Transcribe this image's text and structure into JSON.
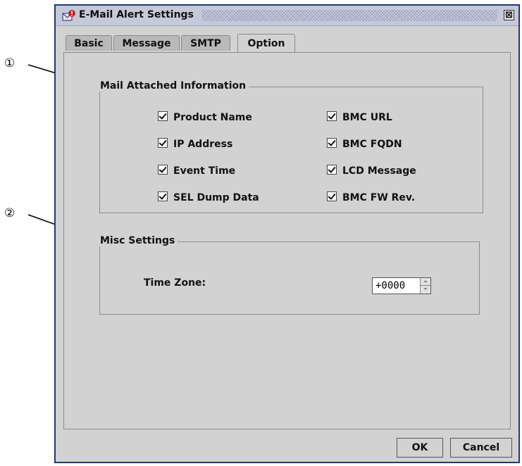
{
  "callouts": {
    "one": "①",
    "two": "②"
  },
  "window": {
    "title": "E-Mail Alert Settings",
    "close_symbol": "⊠"
  },
  "tabs": [
    {
      "label": "Basic"
    },
    {
      "label": "Message"
    },
    {
      "label": "SMTP"
    },
    {
      "label": "Option",
      "active": true
    }
  ],
  "mail_attached": {
    "title": "Mail Attached Information",
    "items": [
      {
        "label": "Product Name",
        "checked": true
      },
      {
        "label": "BMC URL",
        "checked": true
      },
      {
        "label": "IP Address",
        "checked": true
      },
      {
        "label": "BMC FQDN",
        "checked": true
      },
      {
        "label": "Event Time",
        "checked": true
      },
      {
        "label": "LCD Message",
        "checked": true
      },
      {
        "label": "SEL Dump Data",
        "checked": true
      },
      {
        "label": "BMC FW Rev.",
        "checked": true
      }
    ]
  },
  "misc": {
    "title": "Misc Settings",
    "timezone_label": "Time Zone:",
    "timezone_value": "+0000"
  },
  "buttons": {
    "ok": "OK",
    "cancel": "Cancel"
  },
  "colors": {
    "window_border": "#1f3b72",
    "panel_bg": "#d2d2d2"
  },
  "icons": {
    "title": "mail-alert-icon",
    "check": "checkmark-icon"
  }
}
